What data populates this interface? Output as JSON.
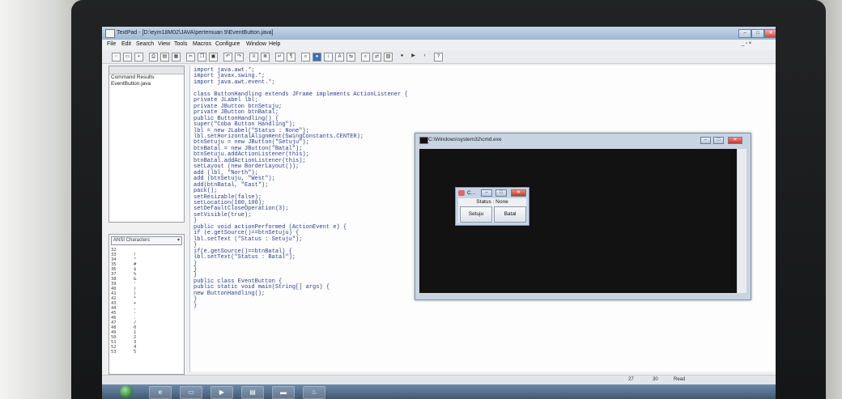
{
  "textpad": {
    "title": "TextPad - [D:\\eym18M02\\JAVA\\pertemuan 9\\EventButton.java]",
    "menu": [
      "File",
      "Edit",
      "Search",
      "View",
      "Tools",
      "Macros",
      "Configure",
      "Window",
      "Help"
    ],
    "documents_header": "",
    "documents": [
      "Command Results",
      "EventButton.java"
    ],
    "clip_library": "ANSI Characters",
    "char_rows": [
      {
        "n": "32",
        "c": ""
      },
      {
        "n": "33",
        "c": "!"
      },
      {
        "n": "34",
        "c": "\""
      },
      {
        "n": "35",
        "c": "#"
      },
      {
        "n": "36",
        "c": "$"
      },
      {
        "n": "37",
        "c": "%"
      },
      {
        "n": "38",
        "c": "&"
      },
      {
        "n": "39",
        "c": "'"
      },
      {
        "n": "40",
        "c": "("
      },
      {
        "n": "41",
        "c": ")"
      },
      {
        "n": "42",
        "c": "*"
      },
      {
        "n": "43",
        "c": "+"
      },
      {
        "n": "44",
        "c": ","
      },
      {
        "n": "45",
        "c": "-"
      },
      {
        "n": "46",
        "c": "."
      },
      {
        "n": "47",
        "c": "/"
      },
      {
        "n": "48",
        "c": "0"
      },
      {
        "n": "49",
        "c": "1"
      },
      {
        "n": "50",
        "c": "2"
      },
      {
        "n": "51",
        "c": "3"
      },
      {
        "n": "52",
        "c": "4"
      },
      {
        "n": "53",
        "c": "5"
      }
    ],
    "code": "import java.awt.*;\nimport javax.swing.*;\nimport java.awt.event.*;\n\nclass ButtonHandling extends JFrame implements ActionListener {\nprivate JLabel lbl;\nprivate JButton btnSetuju;\nprivate JButton btnBatal;\npublic ButtonHandling() {\nsuper(\"Coba Button Handling\");\nlbl = new JLabel(\"Status : None\");\nlbl.setHorizontalAlignment(SwingConstants.CENTER);\nbtnSetuju = new JButton(\"Setuju\");\nbtnBatal = new JButton(\"Batal\");\nbtnSetuju.addActionListener(this);\nbtnBatal.addActionListener(this);\nsetLayout (new BorderLayout());\nadd (lbl, \"North\");\nadd (btnSetuju, \"West\");\nadd(btnBatal, \"East\");\npack();\nsetResizable(false);\nsetLocation(100,100);\nsetDefaultCloseOperation(3);\nsetVisible(true);\n}\npublic void actionPerformed (ActionEvent e) {\nif (e.getSource()==btnSetuju) {\nlbl.setText (\"Status : Setuju\");\n}\nif(e.getSource()==btnBatal) {\nlbl.setText(\"Status : Batal\");\n}\n}\n}\npublic class EventButton {\npublic static void main(String[] args) {\nnew ButtonHandling();\n}\n}",
    "status": {
      "line": "27",
      "col": "30",
      "mode": "Read"
    }
  },
  "cmd": {
    "title": "C:\\Windows\\system32\\cmd.exe"
  },
  "dialog": {
    "title": "C...",
    "status": "Status : None",
    "btn_setuju": "Setuju",
    "btn_batal": "Batal"
  },
  "taskbar": {
    "items": [
      "ie",
      "folder",
      "media",
      "textpad",
      "cmd",
      "java"
    ]
  }
}
